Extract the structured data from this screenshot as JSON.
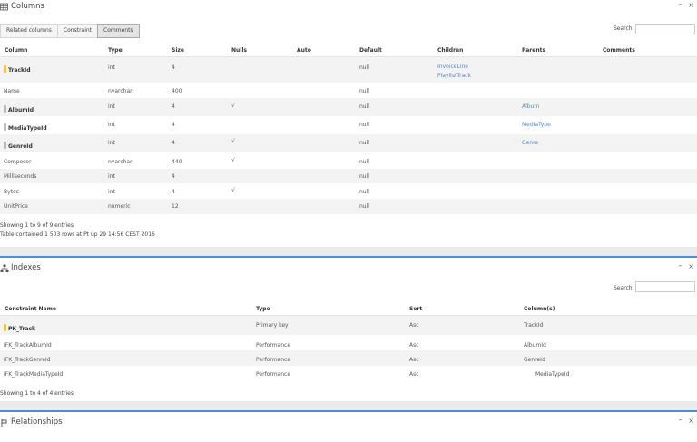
{
  "columns_panel": {
    "title": "Columns",
    "tabs": [
      "Related columns",
      "Constraint",
      "Comments"
    ],
    "active_tab": "Comments",
    "search_label": "Search:",
    "search_value": "",
    "headers": [
      "Column",
      "Type",
      "Size",
      "Nulls",
      "Auto",
      "Default",
      "Children",
      "Parents",
      "Comments"
    ],
    "rows": [
      {
        "column": "TrackId",
        "type": "int",
        "size": "4",
        "nulls": "",
        "auto": "",
        "default": "null",
        "children": [
          "InvoiceLine",
          "PlaylistTrack"
        ],
        "parents": "",
        "comments": "",
        "key": "primary"
      },
      {
        "column": "Name",
        "type": "nvarchar",
        "size": "400",
        "nulls": "",
        "auto": "",
        "default": "null",
        "children": [],
        "parents": "",
        "comments": "",
        "key": ""
      },
      {
        "column": "AlbumId",
        "type": "int",
        "size": "4",
        "nulls": "√",
        "auto": "",
        "default": "null",
        "children": [],
        "parents": "Album",
        "comments": "",
        "key": "foreign"
      },
      {
        "column": "MediaTypeId",
        "type": "int",
        "size": "4",
        "nulls": "",
        "auto": "",
        "default": "null",
        "children": [],
        "parents": "MediaType",
        "comments": "",
        "key": "foreign"
      },
      {
        "column": "GenreId",
        "type": "int",
        "size": "4",
        "nulls": "√",
        "auto": "",
        "default": "null",
        "children": [],
        "parents": "Genre",
        "comments": "",
        "key": "foreign"
      },
      {
        "column": "Composer",
        "type": "nvarchar",
        "size": "440",
        "nulls": "√",
        "auto": "",
        "default": "null",
        "children": [],
        "parents": "",
        "comments": "",
        "key": ""
      },
      {
        "column": "Milliseconds",
        "type": "int",
        "size": "4",
        "nulls": "",
        "auto": "",
        "default": "null",
        "children": [],
        "parents": "",
        "comments": "",
        "key": ""
      },
      {
        "column": "Bytes",
        "type": "int",
        "size": "4",
        "nulls": "√",
        "auto": "",
        "default": "null",
        "children": [],
        "parents": "",
        "comments": "",
        "key": ""
      },
      {
        "column": "UnitPrice",
        "type": "numeric",
        "size": "12",
        "nulls": "",
        "auto": "",
        "default": "null",
        "children": [],
        "parents": "",
        "comments": "",
        "key": ""
      }
    ],
    "info_entries": "Showing 1 to 9 of 9 entries",
    "info_table": "Table contained 1 503 rows at Pt úp 29 14:56 CEST 2016"
  },
  "indexes_panel": {
    "title": "Indexes",
    "search_label": "Search:",
    "search_value": "",
    "headers": [
      "Constraint Name",
      "Type",
      "Sort",
      "Column(s)"
    ],
    "rows": [
      {
        "name": "PK_Track",
        "type": "Primary key",
        "sort": "Asc",
        "columns": "TrackId",
        "key": "primary"
      },
      {
        "name": "IFK_TrackAlbumId",
        "type": "Performance",
        "sort": "Asc",
        "columns": "AlbumId",
        "key": ""
      },
      {
        "name": "IFK_TrackGenreId",
        "type": "Performance",
        "sort": "Asc",
        "columns": "GenreId",
        "key": ""
      },
      {
        "name": "IFK_TrackMediaTypeId",
        "type": "Performance",
        "sort": "Asc",
        "columns": "MediaTypeId",
        "key": ""
      }
    ],
    "info_entries": "Showing 1 to 4 of 4 entries"
  },
  "relationships_panel": {
    "title": "Relationships"
  },
  "controls": {
    "minimize": "–",
    "close": "×"
  },
  "icons": {
    "columns": "table-icon",
    "indexes": "hierarchy-icon",
    "relationships": "relationship-icon"
  },
  "colors": {
    "accent": "#4a90d9",
    "link": "#5b87c4",
    "primary_key": "#e8c545",
    "foreign_key": "#b9b9b9"
  }
}
